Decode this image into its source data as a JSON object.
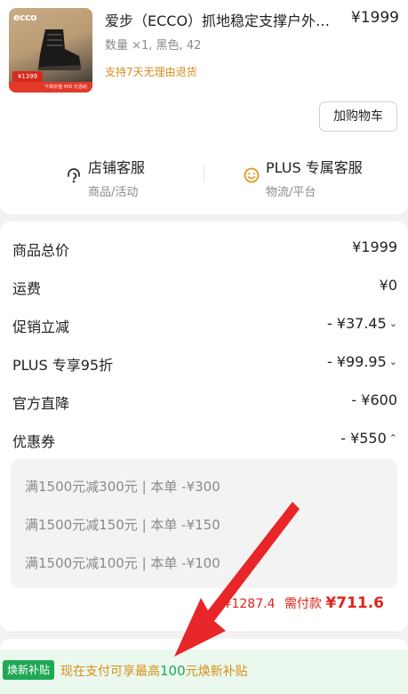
{
  "product": {
    "thumb_brand": "ecco",
    "thumb_promo": "¥1399",
    "thumb_strip": "下单价值 ¥00   元活动",
    "title": "爱步（ECCO）抓地稳定支撑户外…",
    "price": "¥1999",
    "spec": "数量 ×1, 黑色, 42",
    "return_policy": "支持7天无理由退货",
    "add_to_cart": "加购物车"
  },
  "service": {
    "store": {
      "title": "店铺客服",
      "subtitle": "商品/活动",
      "icon": "headset-icon"
    },
    "plus": {
      "title": "PLUS 专属客服",
      "subtitle": "物流/平台",
      "icon": "smile-face-icon"
    }
  },
  "summary": {
    "rows": [
      {
        "label": "商品总价",
        "value": "¥1999",
        "chevron": ""
      },
      {
        "label": "运费",
        "value": "¥0",
        "chevron": ""
      },
      {
        "label": "促销立减",
        "value": "- ¥37.45",
        "chevron": "⌄"
      },
      {
        "label": "PLUS 专享95折",
        "value": "- ¥99.95",
        "chevron": "⌄"
      },
      {
        "label": "官方直降",
        "value": "- ¥600",
        "chevron": ""
      },
      {
        "label": "优惠券",
        "value": "- ¥550",
        "chevron": "⌃"
      }
    ],
    "coupons": [
      "满1500元减300元 | 本单 -¥300",
      "满1500元减150元 | 本单 -¥150",
      "满1500元减100元 | 本单 -¥100"
    ],
    "discount_total": "¥1287.4",
    "pay_label": "需付款",
    "pay_amount": "¥711.6"
  },
  "trade_in": {
    "badge": "焕新补贴",
    "text_before": "现在支付可享最高",
    "amount": "100",
    "text_after": "元焕新补贴"
  },
  "colors": {
    "accent_red": "#e2231a",
    "accent_orange": "#d9901a",
    "accent_green": "#1fa855"
  }
}
